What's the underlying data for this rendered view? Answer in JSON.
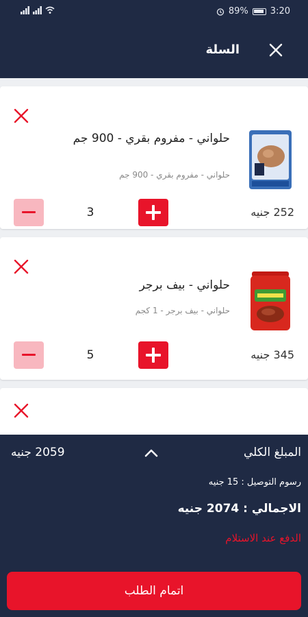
{
  "statusbar": {
    "time": "3:20",
    "battery": "89%"
  },
  "header": {
    "title": "السلة",
    "close_icon": "close-icon"
  },
  "cart": {
    "items": [
      {
        "name": "حلواني - مفروم بقري - 900 جم",
        "subtitle": "حلواني - مفروم بقري - 900 جم",
        "price": "252 جنيه",
        "quantity": "3",
        "image_icon": "minced-beef-pack"
      },
      {
        "name": "حلواني - بيف برجر",
        "subtitle": "حلواني - بيف برجر - 1 كجم",
        "price": "345 جنيه",
        "quantity": "5",
        "image_icon": "beef-burger-pack"
      }
    ]
  },
  "summary": {
    "subtotal_label": "المبلغ الكلي",
    "subtotal_value": "2059 جنيه",
    "delivery": "رسوم التوصيل : 15 جنيه",
    "total": "الاجمالي : 2074 جنيه",
    "payment": "الدفع عند الاستلام",
    "checkout_label": "اتمام الطلب"
  },
  "colors": {
    "navy": "#1f2a44",
    "accent_red": "#e8142a",
    "light_red": "#f8b7bf"
  }
}
